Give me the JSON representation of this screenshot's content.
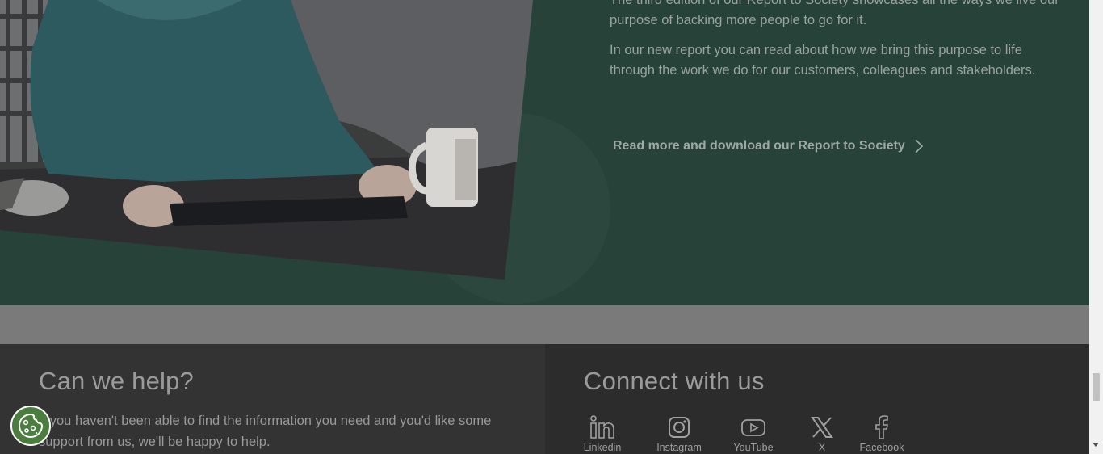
{
  "report": {
    "paragraph_1": "The third edition of our Report to Society showcases all the ways we live our purpose of backing more people to go for it.",
    "paragraph_2": "In our new report you can read about how we bring this purpose to life through the work we do for our customers, colleagues and stakeholders.",
    "cta_label": "Read more and download our Report to Society"
  },
  "help": {
    "title": "Can we help?",
    "text": "If you haven't been able to find the information you need and you'd like some support from us, we'll be happy to help."
  },
  "connect": {
    "title": "Connect with us",
    "social": [
      {
        "label": "Linkedin",
        "icon": "linkedin-icon"
      },
      {
        "label": "Instagram",
        "icon": "instagram-icon"
      },
      {
        "label": "YouTube",
        "icon": "youtube-icon"
      },
      {
        "label": "X",
        "icon": "x-icon"
      },
      {
        "label": "Facebook",
        "icon": "facebook-icon"
      }
    ]
  },
  "cookie_button": {
    "icon": "cookie-icon"
  },
  "colors": {
    "report_bg": "#274239",
    "help_bg": "#333333",
    "connect_bg": "#2c2c2c",
    "cookie_bg": "#4a7d3e"
  }
}
